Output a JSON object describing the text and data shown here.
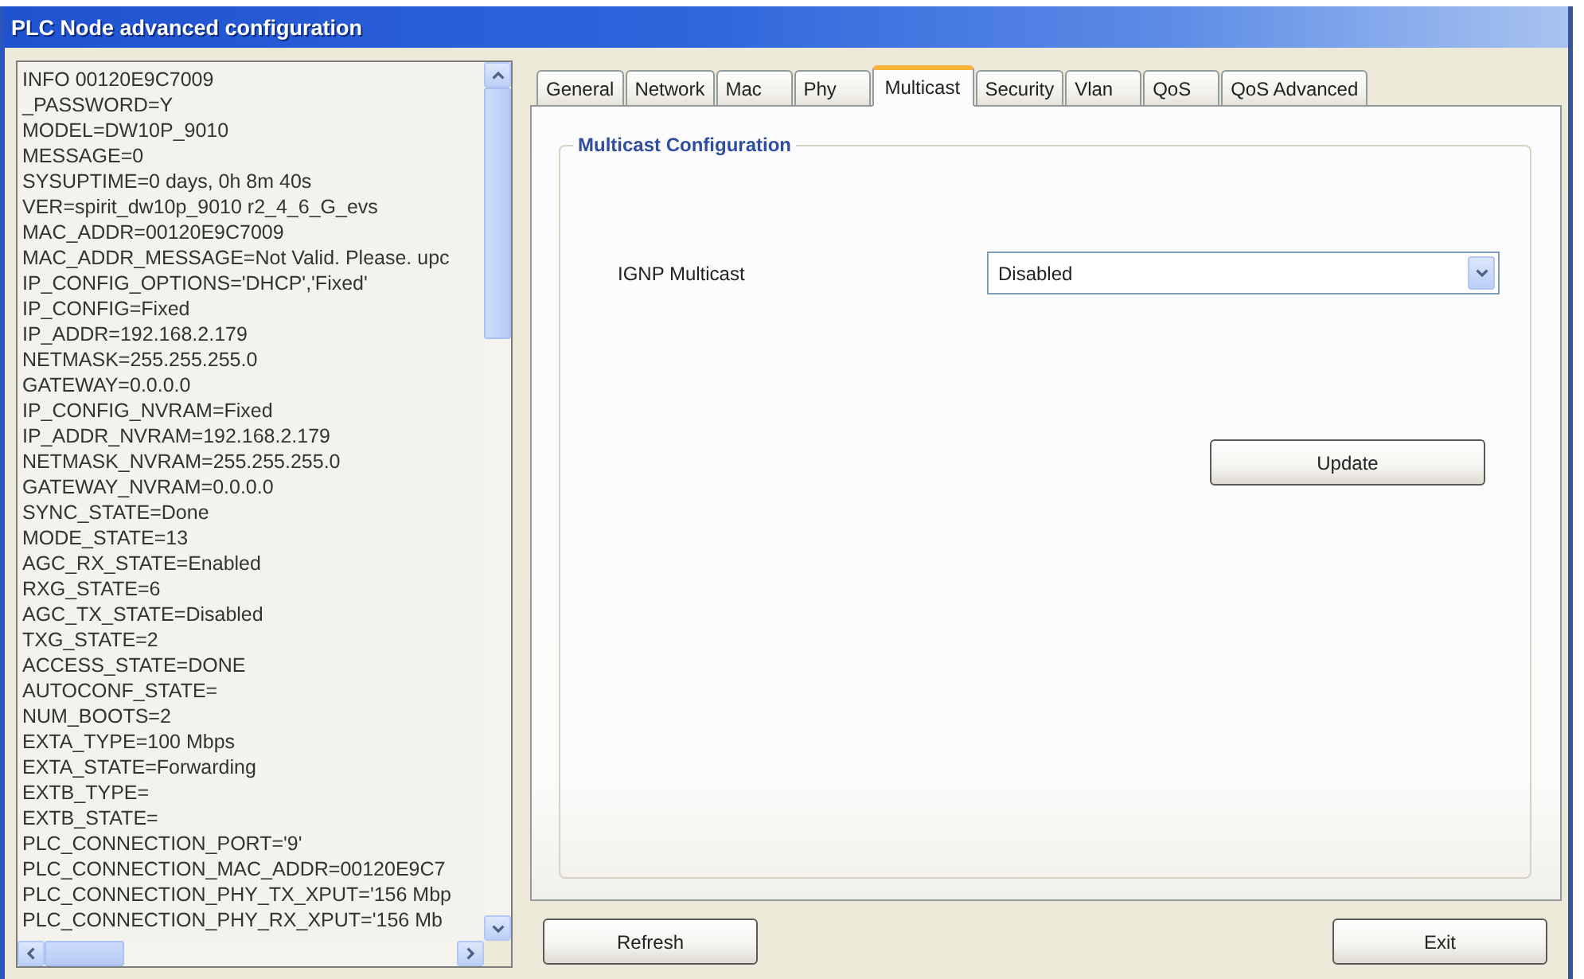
{
  "window": {
    "title": "PLC Node advanced configuration"
  },
  "info_list": [
    "INFO 00120E9C7009",
    "_PASSWORD=Y",
    "MODEL=DW10P_9010",
    "MESSAGE=0",
    "SYSUPTIME=0 days, 0h 8m 40s",
    "VER=spirit_dw10p_9010 r2_4_6_G_evs",
    "MAC_ADDR=00120E9C7009",
    "MAC_ADDR_MESSAGE=Not Valid. Please. upc",
    "IP_CONFIG_OPTIONS='DHCP','Fixed'",
    "IP_CONFIG=Fixed",
    "IP_ADDR=192.168.2.179",
    "NETMASK=255.255.255.0",
    "GATEWAY=0.0.0.0",
    "IP_CONFIG_NVRAM=Fixed",
    "IP_ADDR_NVRAM=192.168.2.179",
    "NETMASK_NVRAM=255.255.255.0",
    "GATEWAY_NVRAM=0.0.0.0",
    "SYNC_STATE=Done",
    "MODE_STATE=13",
    "AGC_RX_STATE=Enabled",
    "RXG_STATE=6",
    "AGC_TX_STATE=Disabled",
    "TXG_STATE=2",
    "ACCESS_STATE=DONE",
    "AUTOCONF_STATE=",
    "NUM_BOOTS=2",
    "EXTA_TYPE=100 Mbps",
    "EXTA_STATE=Forwarding",
    "EXTB_TYPE=",
    "EXTB_STATE=",
    "PLC_CONNECTION_PORT='9'",
    "PLC_CONNECTION_MAC_ADDR=00120E9C7",
    "PLC_CONNECTION_PHY_TX_XPUT='156 Mbp",
    "PLC_CONNECTION_PHY_RX_XPUT='156 Mb"
  ],
  "tabs": [
    {
      "label": "General",
      "selected": false
    },
    {
      "label": "Network",
      "selected": false
    },
    {
      "label": "Mac",
      "selected": false
    },
    {
      "label": "Phy",
      "selected": false
    },
    {
      "label": "Multicast",
      "selected": true
    },
    {
      "label": "Security",
      "selected": false
    },
    {
      "label": "Vlan",
      "selected": false
    },
    {
      "label": "QoS",
      "selected": false
    },
    {
      "label": "QoS Advanced",
      "selected": false
    }
  ],
  "multicast_panel": {
    "title": "Multicast Configuration",
    "field_label": "IGNP Multicast",
    "dropdown_value": "Disabled",
    "update_button": "Update"
  },
  "footer": {
    "refresh_button": "Refresh",
    "exit_button": "Exit"
  }
}
